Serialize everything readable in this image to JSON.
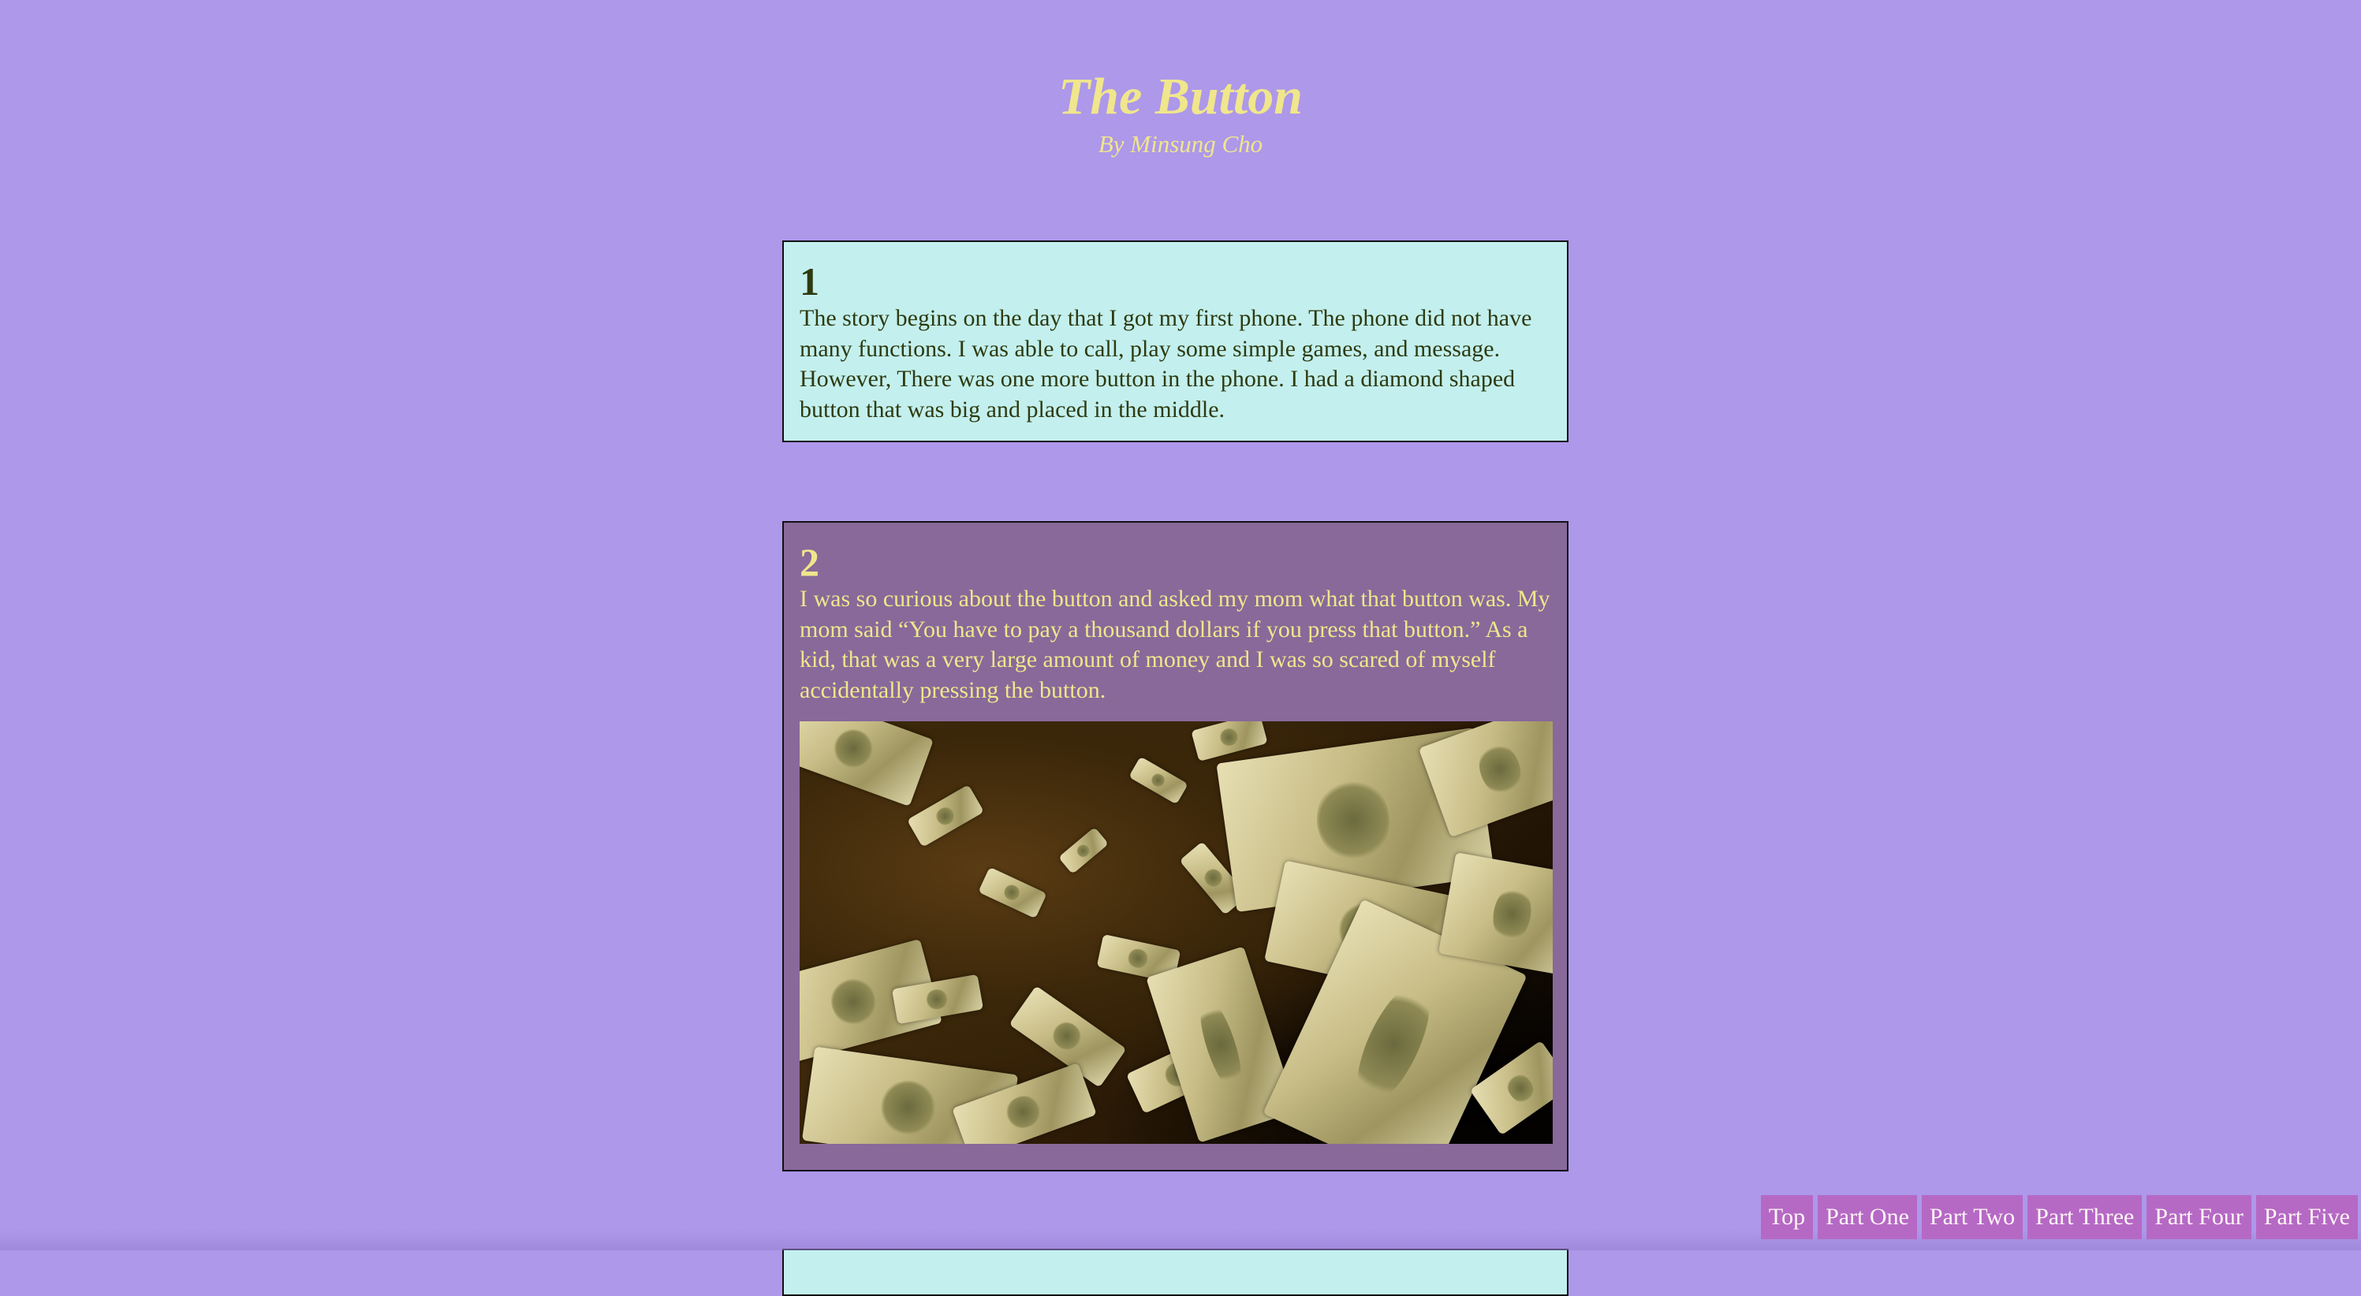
{
  "header": {
    "title": "The Button",
    "byline": "By Minsung Cho"
  },
  "sections": [
    {
      "number": "1",
      "text": "The story begins on the day that I got my first phone. The phone did not have many functions. I was able to call, play some simple games, and message. However, There was one more button in the phone. I had a diamond shaped button that was big and placed in the middle."
    },
    {
      "number": "2",
      "text": "I was so curious about the button and asked my mom what that button was. My mom said “You have to pay a thousand dollars if you press that button.” As a kid, that was a very large amount of money and I was so scared of myself accidentally pressing the button."
    }
  ],
  "nav": [
    "Top",
    "Part One",
    "Part Two",
    "Part Three",
    "Part Four",
    "Part Five"
  ],
  "colors": {
    "page_background": "#ad98ea",
    "title": "#f0e68c",
    "card_light": "#c3f0ee",
    "card_dark": "#88699a",
    "nav_button": "#b569c5"
  }
}
